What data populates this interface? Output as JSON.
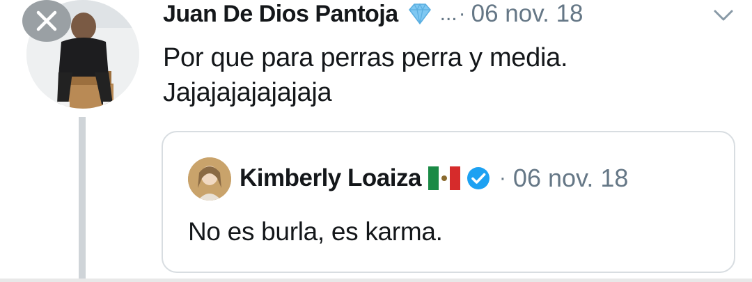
{
  "tweet": {
    "author_name": "Juan De Dios Pantoja",
    "name_badge_icon": "diamond-icon",
    "ellipsis": "...",
    "separator": "·",
    "date": "06 nov. 18",
    "text_line1": "Por que para perras perra y media.",
    "text_line2": "Jajajajajajajaja"
  },
  "quoted_tweet": {
    "author_name": "Kimberly Loaiza",
    "flag_icon": "mexico-flag-icon",
    "verified_icon": "verified-badge-icon",
    "separator": "·",
    "date": "06 nov. 18",
    "text": "No es burla, es karma."
  },
  "colors": {
    "text": "#14171a",
    "muted": "#657786",
    "verified_blue": "#1da1f2",
    "diamond_blue": "#7fc8f2",
    "card_border": "#d8dde1",
    "thread_line": "#cfd4d8",
    "close_overlay": "#9aa0a4"
  }
}
